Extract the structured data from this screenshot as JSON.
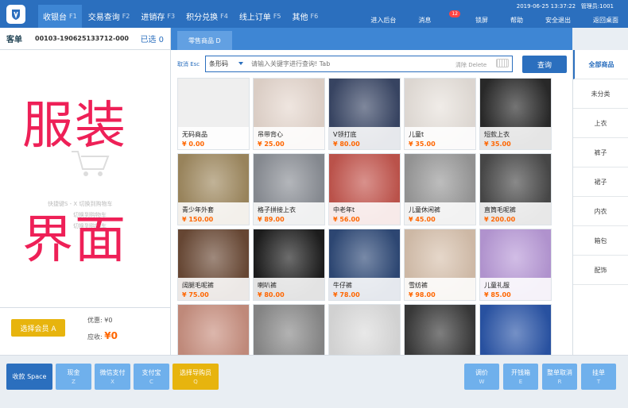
{
  "topnav": {
    "tabs": [
      {
        "label": "收银台",
        "key": "F1"
      },
      {
        "label": "交易查询",
        "key": "F2"
      },
      {
        "label": "进销存",
        "key": "F3"
      },
      {
        "label": "积分兑换",
        "key": "F4"
      },
      {
        "label": "线上订单",
        "key": "F5"
      },
      {
        "label": "其他",
        "key": "F6"
      }
    ],
    "datetime": "2019-06-25 13:37:22",
    "user": "管理员:1001",
    "links": [
      "进入后台",
      "消息",
      "锁屏",
      "帮助",
      "安全退出",
      "返回桌面"
    ],
    "message_badge": "12"
  },
  "order": {
    "label": "客单",
    "number": "00103-190625133712-000",
    "selected": "已选 0",
    "overlay_line1": "服装",
    "overlay_line2": "界面",
    "hint1": "快捷键S - X 切换到购物车",
    "hint2": "切换到购物车",
    "hint3": "切换到购物车",
    "member_button": "选择会员 A",
    "discount": "优惠: ¥0",
    "due_label": "应收:",
    "due_value": "¥0"
  },
  "subtab": "零售商品 D",
  "search": {
    "cancel": "取消 Esc",
    "type": "条形码",
    "placeholder": "请输入关键字进行查询! Tab",
    "clear": "清除 Delete",
    "query": "查询"
  },
  "products": [
    {
      "name": "无码商品",
      "price": "¥ 0.00",
      "color": "#efefef"
    },
    {
      "name": "吊带背心",
      "price": "¥ 25.00",
      "color": "#e6d8cf"
    },
    {
      "name": "V领打底",
      "price": "¥ 80.00",
      "color": "#3a4766"
    },
    {
      "name": "儿童t",
      "price": "¥ 35.00",
      "color": "#e8e2dc"
    },
    {
      "name": "短款上衣",
      "price": "¥ 35.00",
      "color": "#2a2a2a"
    },
    {
      "name": "青少年外套",
      "price": "¥ 150.00",
      "color": "#a08a60"
    },
    {
      "name": "格子拼接上衣",
      "price": "¥ 89.00",
      "color": "#8b8f96"
    },
    {
      "name": "中老年t",
      "price": "¥ 56.00",
      "color": "#c4564e"
    },
    {
      "name": "儿童休闲裤",
      "price": "¥ 45.00",
      "color": "#9a9a9a"
    },
    {
      "name": "直筒毛呢裤",
      "price": "¥ 200.00",
      "color": "#4a4a4a"
    },
    {
      "name": "阔腿毛呢裤",
      "price": "¥ 75.00",
      "color": "#6b4a36"
    },
    {
      "name": "喇叭裤",
      "price": "¥ 80.00",
      "color": "#1e1e1e"
    },
    {
      "name": "牛仔裤",
      "price": "¥ 78.00",
      "color": "#2f4a78"
    },
    {
      "name": "雪纺裤",
      "price": "¥ 98.00",
      "color": "#d8c2ae"
    },
    {
      "name": "儿童礼服",
      "price": "¥ 85.00",
      "color": "#b99ad8"
    },
    {
      "name": "",
      "price": "",
      "color": "#c99080"
    },
    {
      "name": "",
      "price": "",
      "color": "#8a8a8a"
    },
    {
      "name": "",
      "price": "",
      "color": "#dcdcdc"
    },
    {
      "name": "",
      "price": "",
      "color": "#3a3a3a"
    },
    {
      "name": "",
      "price": "",
      "color": "#2a55a8"
    }
  ],
  "categories": [
    "全部商品",
    "未分类",
    "上衣",
    "裤子",
    "裙子",
    "内衣",
    "箱包",
    "配饰"
  ],
  "bottom": {
    "left": [
      {
        "label": "收款 Space",
        "key": "",
        "style": "dark"
      },
      {
        "label": "现金",
        "key": "Z",
        "style": "light"
      },
      {
        "label": "微信支付",
        "key": "X",
        "style": "light"
      },
      {
        "label": "支付宝",
        "key": "C",
        "style": "light"
      },
      {
        "label": "选择导购员",
        "key": "Q",
        "style": "yellow"
      }
    ],
    "right": [
      {
        "label": "调价",
        "key": "W",
        "style": "light"
      },
      {
        "label": "开钱箱",
        "key": "E",
        "style": "light"
      },
      {
        "label": "整单取消",
        "key": "R",
        "style": "light"
      },
      {
        "label": "挂单",
        "key": "T",
        "style": "light"
      }
    ]
  }
}
